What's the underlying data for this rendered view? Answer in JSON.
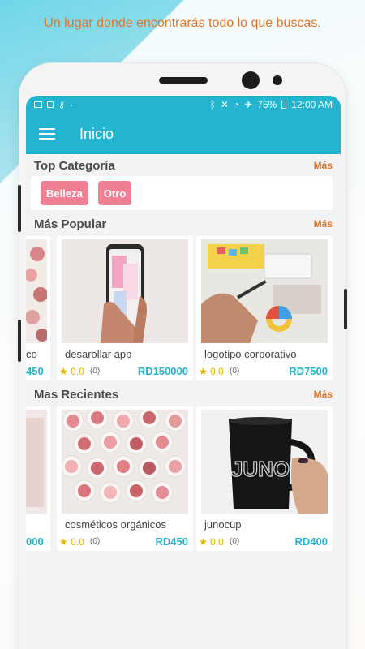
{
  "tagline": "Un lugar donde encontrarás todo lo que buscas.",
  "status_bar": {
    "battery": "75%",
    "time": "12:00 AM"
  },
  "app_bar": {
    "title": "Inicio"
  },
  "top_categories": {
    "title": "Top Categoría",
    "more": "Más",
    "chips": [
      "Belleza",
      "Otro"
    ]
  },
  "popular": {
    "title": "Más Popular",
    "more": "Más",
    "partial": {
      "title": "co",
      "price": "450"
    },
    "cards": [
      {
        "title": "desarollar app",
        "rating": "0.0",
        "count": "(0)",
        "price": "RD150000",
        "image": "phone-in-hand"
      },
      {
        "title": "logotipo corporativo",
        "rating": "0.0",
        "count": "(0)",
        "price": "RD7500",
        "image": "design-desk"
      }
    ]
  },
  "recent": {
    "title": "Mas Recientes",
    "more": "Más",
    "partial": {
      "price": "000"
    },
    "cards": [
      {
        "title": "cosméticos orgánicos",
        "rating": "0.0",
        "count": "(0)",
        "price": "RD450",
        "image": "lip-balms"
      },
      {
        "title": "junocup",
        "rating": "0.0",
        "count": "(0)",
        "price": "RD400",
        "image": "black-mug",
        "mug_text": "JUNO"
      }
    ]
  },
  "colors": {
    "primary": "#23b5cf",
    "accent": "#e0772b",
    "chip": "#f07f94",
    "star": "#e0b400"
  },
  "bottom_nav": [
    "home-icon",
    "explore-icon",
    "cart-icon",
    "list-icon",
    "settings-icon"
  ]
}
